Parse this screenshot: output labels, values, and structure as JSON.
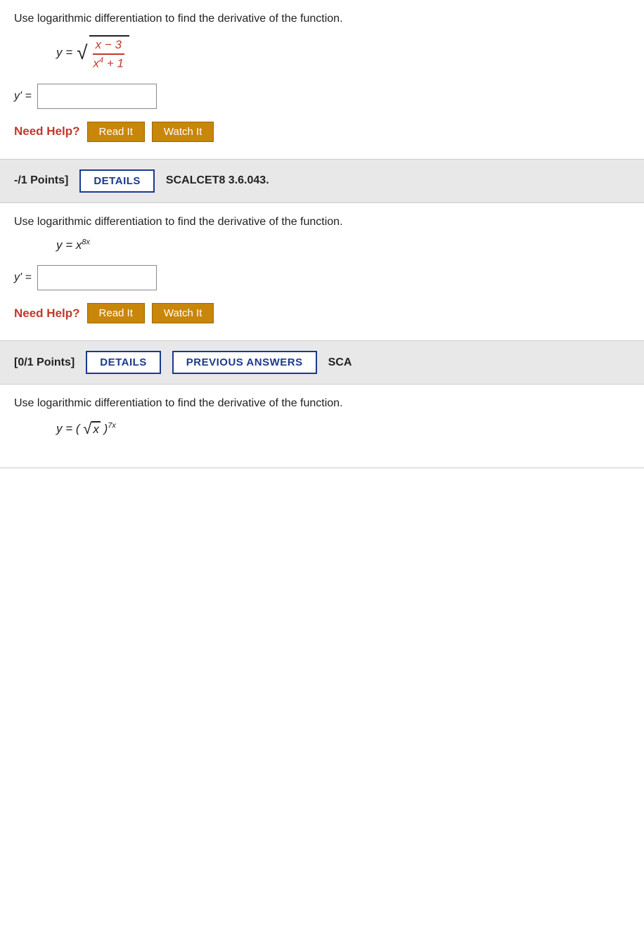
{
  "sections": [
    {
      "id": "section1",
      "problemText": "Use logarithmic differentiation to find the derivative of the function.",
      "formula": "sqrt_fraction",
      "formulaDesc": "y = sqrt((x - 3) / (x^4 + 1))",
      "answerLabel": "y' =",
      "needHelpLabel": "Need Help?",
      "readItLabel": "Read It",
      "watchItLabel": "Watch It"
    },
    {
      "id": "section2",
      "headerPointsLabel": "-/1 Points]",
      "headerDetailsLabel": "DETAILS",
      "headerScalcetLabel": "SCALCET8 3.6.043.",
      "problemText": "Use logarithmic differentiation to find the derivative of the function.",
      "formula": "x_power_8x",
      "formulaDesc": "y = x^(8x)",
      "answerLabel": "y' =",
      "needHelpLabel": "Need Help?",
      "readItLabel": "Read It",
      "watchItLabel": "Watch It"
    },
    {
      "id": "section3",
      "headerPointsLabel": "[0/1 Points]",
      "headerDetailsLabel": "DETAILS",
      "headerPrevAnswersLabel": "PREVIOUS ANSWERS",
      "headerScaLabel": "SCA",
      "problemText": "Use logarithmic differentiation to find the derivative of the function.",
      "formula": "sqrt_x_power_7x",
      "formulaDesc": "y = (sqrt(x))^(7x)"
    }
  ]
}
